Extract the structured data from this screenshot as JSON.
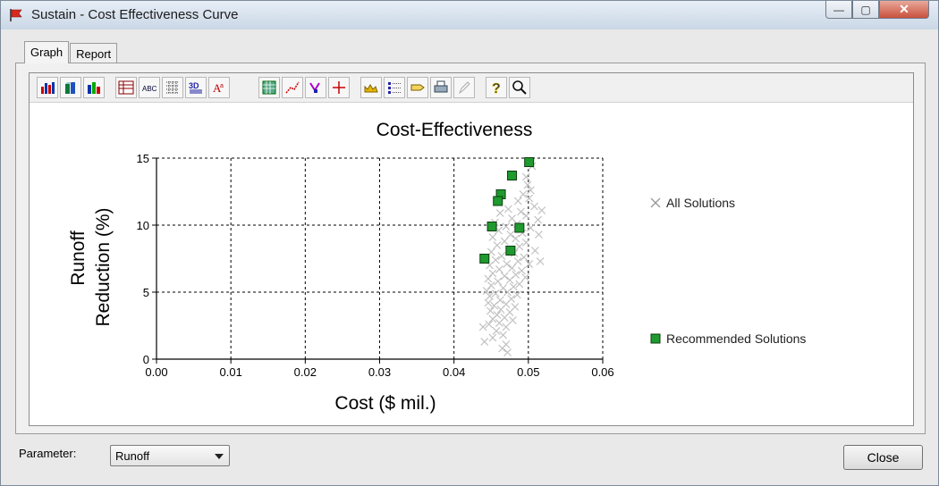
{
  "window": {
    "title": "Sustain - Cost Effectiveness Curve",
    "controls": {
      "minimize": "—",
      "maximize": "▢",
      "close": "✕"
    }
  },
  "tabs": [
    {
      "label": "Graph",
      "active": true
    },
    {
      "label": "Report",
      "active": false
    }
  ],
  "toolbar": {
    "icons": [
      "bar-chart-icon",
      "3d-bar-icon",
      "stacked-bar-icon",
      "data-grid-icon",
      "text-labels-icon",
      "grid-lines-icon",
      "3d-view-icon",
      "font-icon",
      "pattern-icon",
      "trend-icon",
      "markers-icon",
      "crosshair-icon",
      "palette-icon",
      "legend-icon",
      "tag-icon",
      "print-icon",
      "edit-icon",
      "help-icon",
      "zoom-icon"
    ]
  },
  "chart_data": {
    "type": "scatter",
    "title": "Cost-Effectiveness",
    "xlabel": "Cost ($ mil.)",
    "ylabel_lines": [
      "Runoff",
      "Reduction (%)"
    ],
    "xlim": [
      0,
      0.06
    ],
    "ylim": [
      0,
      15
    ],
    "xticks": [
      "0.00",
      "0.01",
      "0.02",
      "0.03",
      "0.04",
      "0.05",
      "0.06"
    ],
    "yticks": [
      "0",
      "5",
      "10",
      "15"
    ],
    "grid": true,
    "legend_position": "right",
    "series": [
      {
        "name": "All Solutions",
        "marker": "x",
        "color": "#bfbfbf",
        "points": [
          [
            0.0505,
            14.4
          ],
          [
            0.0497,
            13.6
          ],
          [
            0.0499,
            13.0
          ],
          [
            0.0503,
            12.6
          ],
          [
            0.0493,
            12.3
          ],
          [
            0.0501,
            12.0
          ],
          [
            0.0486,
            11.8
          ],
          [
            0.0508,
            11.4
          ],
          [
            0.0473,
            11.2
          ],
          [
            0.049,
            11.0
          ],
          [
            0.0518,
            11.1
          ],
          [
            0.0462,
            10.9
          ],
          [
            0.0497,
            10.7
          ],
          [
            0.0478,
            10.5
          ],
          [
            0.0513,
            10.4
          ],
          [
            0.0455,
            10.2
          ],
          [
            0.0485,
            10.1
          ],
          [
            0.047,
            9.9
          ],
          [
            0.0503,
            9.8
          ],
          [
            0.046,
            9.6
          ],
          [
            0.0492,
            9.4
          ],
          [
            0.0476,
            9.3
          ],
          [
            0.0514,
            9.3
          ],
          [
            0.0452,
            9.1
          ],
          [
            0.0483,
            9.0
          ],
          [
            0.0468,
            8.8
          ],
          [
            0.0497,
            8.7
          ],
          [
            0.0458,
            8.5
          ],
          [
            0.0488,
            8.4
          ],
          [
            0.0474,
            8.2
          ],
          [
            0.0509,
            8.1
          ],
          [
            0.045,
            8.0
          ],
          [
            0.0481,
            7.9
          ],
          [
            0.0464,
            7.7
          ],
          [
            0.0494,
            7.6
          ],
          [
            0.0516,
            7.3
          ],
          [
            0.0456,
            7.4
          ],
          [
            0.0486,
            7.3
          ],
          [
            0.0471,
            7.1
          ],
          [
            0.0501,
            7.1
          ],
          [
            0.0448,
            7.0
          ],
          [
            0.0478,
            6.8
          ],
          [
            0.0461,
            6.7
          ],
          [
            0.0491,
            6.6
          ],
          [
            0.0452,
            6.4
          ],
          [
            0.0483,
            6.3
          ],
          [
            0.0468,
            6.2
          ],
          [
            0.0496,
            6.1
          ],
          [
            0.0446,
            6.0
          ],
          [
            0.0475,
            5.9
          ],
          [
            0.0459,
            5.8
          ],
          [
            0.0488,
            5.6
          ],
          [
            0.045,
            5.5
          ],
          [
            0.048,
            5.4
          ],
          [
            0.0466,
            5.3
          ],
          [
            0.0444,
            5.1
          ],
          [
            0.0472,
            5.0
          ],
          [
            0.0456,
            4.9
          ],
          [
            0.0485,
            4.8
          ],
          [
            0.0448,
            4.7
          ],
          [
            0.0477,
            4.5
          ],
          [
            0.0462,
            4.4
          ],
          [
            0.0446,
            4.2
          ],
          [
            0.047,
            4.1
          ],
          [
            0.0454,
            4.0
          ],
          [
            0.0482,
            3.9
          ],
          [
            0.0463,
            3.7
          ],
          [
            0.0449,
            3.6
          ],
          [
            0.0475,
            3.5
          ],
          [
            0.0458,
            3.3
          ],
          [
            0.0468,
            3.1
          ],
          [
            0.0452,
            3.0
          ],
          [
            0.0479,
            2.9
          ],
          [
            0.0461,
            2.7
          ],
          [
            0.0447,
            2.6
          ],
          [
            0.047,
            2.4
          ],
          [
            0.0439,
            2.4
          ],
          [
            0.0457,
            2.1
          ],
          [
            0.0466,
            1.8
          ],
          [
            0.0452,
            1.6
          ],
          [
            0.0441,
            1.3
          ],
          [
            0.047,
            1.1
          ],
          [
            0.0465,
            0.8
          ],
          [
            0.0472,
            0.5
          ]
        ]
      },
      {
        "name": "Recommended Solutions",
        "marker": "square",
        "color": "#1f9a2e",
        "points": [
          [
            0.0501,
            14.7
          ],
          [
            0.0478,
            13.7
          ],
          [
            0.0463,
            12.3
          ],
          [
            0.0459,
            11.8
          ],
          [
            0.0451,
            9.9
          ],
          [
            0.0488,
            9.8
          ],
          [
            0.0476,
            8.1
          ],
          [
            0.0441,
            7.5
          ]
        ]
      }
    ]
  },
  "bottom": {
    "parameter_label": "Parameter:",
    "parameter_value": "Runoff",
    "close_label": "Close"
  }
}
